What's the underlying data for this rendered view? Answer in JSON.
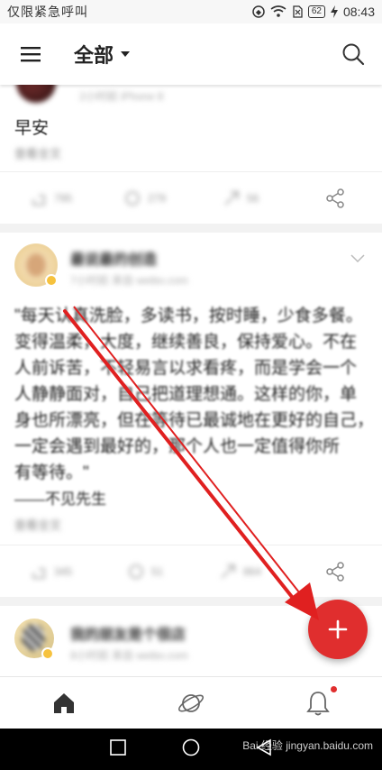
{
  "status_bar": {
    "carrier_text": "仅限紧急呼叫",
    "battery": "62",
    "time": "08:43"
  },
  "app_bar": {
    "title": "全部",
    "menu_icon": "hamburger-menu-icon",
    "search_icon": "search-icon"
  },
  "feed": {
    "posts": [
      {
        "meta": "2小时前  iPhone 8",
        "text": "早安",
        "check_more": "查看全文",
        "actions": {
          "repost": "795",
          "comment": "279",
          "like": "56"
        }
      },
      {
        "author": "最说最的创造",
        "meta": "7小时前  来自 weibo.com",
        "text_lines": [
          "\"每天认真洗脸，多读书，按时睡，少食多餐。",
          "变得温柔，大度，继续善良，保持爱心。不在",
          "人前诉苦，不轻易言以求看疼，而是学会一个",
          "人静静面对，自己把道理想通。这样的你，单",
          "身也所漂亮，但在等待已最诚地在更好的自己，",
          "一定会遇到最好的，那个人也一定值得你所",
          "有等待。\""
        ],
        "signature": "——不见先生",
        "check_more": "查看全文",
        "actions": {
          "repost": "345",
          "comment": "51",
          "like": "864"
        }
      },
      {
        "author": "我的朋友是个很店",
        "meta": "8小时前  来自 weibo.com"
      }
    ]
  },
  "fab": {
    "icon": "plus-icon"
  },
  "bottom_nav": {
    "items": [
      "home-icon",
      "discover-planet-icon",
      "notification-bell-icon"
    ]
  },
  "watermark": "Bai 经验 jingyan.baidu.com",
  "colors": {
    "accent": "#e02e2e",
    "annotation_arrow": "#e02020"
  }
}
